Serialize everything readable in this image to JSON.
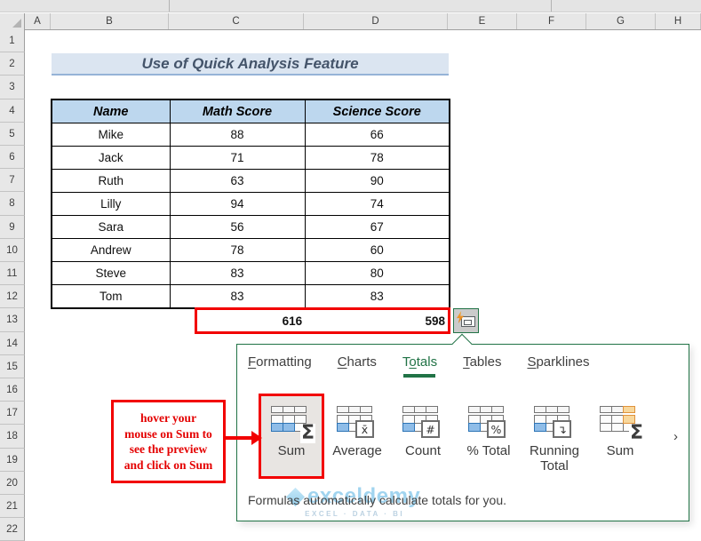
{
  "sheet": {
    "columns": [
      "A",
      "B",
      "C",
      "D",
      "E",
      "F",
      "G",
      "H"
    ],
    "rows": [
      "1",
      "2",
      "3",
      "4",
      "5",
      "6",
      "7",
      "8",
      "9",
      "10",
      "11",
      "12",
      "13",
      "14",
      "15",
      "16",
      "17",
      "18",
      "19",
      "20",
      "21",
      "22"
    ]
  },
  "title": {
    "text": "Use of Quick Analysis Feature"
  },
  "table": {
    "headers": [
      "Name",
      "Math Score",
      "Science Score"
    ],
    "rows": [
      [
        "Mike",
        "88",
        "66"
      ],
      [
        "Jack",
        "71",
        "78"
      ],
      [
        "Ruth",
        "63",
        "90"
      ],
      [
        "Lilly",
        "94",
        "74"
      ],
      [
        "Sara",
        "56",
        "67"
      ],
      [
        "Andrew",
        "78",
        "60"
      ],
      [
        "Steve",
        "83",
        "80"
      ],
      [
        "Tom",
        "83",
        "83"
      ]
    ],
    "totals": {
      "math": "616",
      "science": "598"
    }
  },
  "quick_analysis": {
    "tabs": [
      {
        "pre": "",
        "key": "F",
        "post": "ormatting"
      },
      {
        "pre": "",
        "key": "C",
        "post": "harts"
      },
      {
        "pre": "T",
        "key": "o",
        "post": "tals"
      },
      {
        "pre": "",
        "key": "T",
        "post": "ables"
      },
      {
        "pre": "",
        "key": "S",
        "post": "parklines"
      }
    ],
    "active_tab": "Totals",
    "items": [
      {
        "label": "Sum",
        "symbol": "Σ",
        "variant": "sum-rows",
        "selected": true
      },
      {
        "label": "Average",
        "symbol": "x̄",
        "variant": "boxed",
        "selected": false
      },
      {
        "label": "Count",
        "symbol": "#",
        "variant": "boxed",
        "selected": false
      },
      {
        "label": "% Total",
        "symbol": "%",
        "variant": "boxed",
        "selected": false
      },
      {
        "label": "Running Total",
        "symbol": "↴",
        "variant": "boxed",
        "selected": false
      },
      {
        "label": "Sum",
        "symbol": "Σ",
        "variant": "sum-columns",
        "selected": false
      }
    ],
    "nav": {
      "prev": "‹",
      "next": "›"
    },
    "footer": "Formulas automatically calculate totals for you."
  },
  "annotation": {
    "text": "hover your\nmouse on Sum to\nsee the preview\nand click on Sum"
  },
  "watermark": {
    "brand": "exceldemy",
    "tagline": "EXCEL · DATA · BI"
  },
  "colors": {
    "excel_green": "#217346",
    "highlight_red": "#f20000",
    "table_header_blue": "#bdd7ee",
    "title_band_blue": "#dbe5f1",
    "title_band_border": "#95b3d7",
    "title_text": "#44546a",
    "icon_cell_blue": "#8fbde8",
    "icon_cell_orange": "#f8d89d",
    "watermark_blue": "#45abe0"
  }
}
